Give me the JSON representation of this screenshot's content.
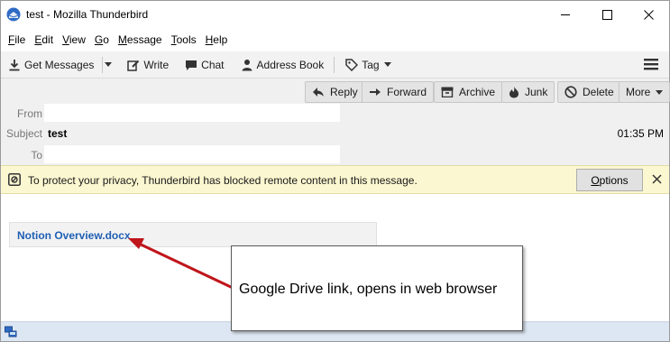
{
  "window": {
    "title": "test - Mozilla Thunderbird"
  },
  "menu": [
    {
      "prefix": "",
      "accel": "F",
      "rest": "ile"
    },
    {
      "prefix": "",
      "accel": "E",
      "rest": "dit"
    },
    {
      "prefix": "",
      "accel": "V",
      "rest": "iew"
    },
    {
      "prefix": "",
      "accel": "G",
      "rest": "o"
    },
    {
      "prefix": "",
      "accel": "M",
      "rest": "essage"
    },
    {
      "prefix": "",
      "accel": "T",
      "rest": "ools"
    },
    {
      "prefix": "",
      "accel": "H",
      "rest": "elp"
    }
  ],
  "toolbar": {
    "get_messages": "Get Messages",
    "write": "Write",
    "chat": "Chat",
    "address_book": "Address Book",
    "tag": "Tag"
  },
  "header_buttons": {
    "reply": "Reply",
    "forward": "Forward",
    "archive": "Archive",
    "junk": "Junk",
    "delete": "Delete",
    "more": "More"
  },
  "header_fields": {
    "from_label": "From",
    "subject_label": "Subject",
    "to_label": "To",
    "subject_value": "test",
    "time": "01:35 PM"
  },
  "notification": {
    "text": "To protect your privacy, Thunderbird has blocked remote content in this message.",
    "options_label": "Options",
    "options_accel": "O",
    "options_rest": "ptions"
  },
  "body": {
    "attachment_link": "Notion Overview.docx"
  },
  "callout": {
    "text": "Google Drive link, opens in web browser"
  },
  "colors": {
    "link": "#1f5fb4",
    "notify_bg": "#fbf7d0",
    "arrow": "#c0151b",
    "statusbar": "#dde7f3"
  },
  "icons": [
    "thunderbird-icon",
    "minimize-icon",
    "maximize-icon",
    "close-icon",
    "download-icon",
    "pencil-icon",
    "chat-bubble-icon",
    "person-icon",
    "tag-icon",
    "hamburger-menu-icon",
    "reply-icon",
    "forward-icon",
    "archive-icon",
    "junk-flame-icon",
    "delete-icon",
    "remote-content-icon",
    "notification-close-icon",
    "online-status-icon"
  ]
}
